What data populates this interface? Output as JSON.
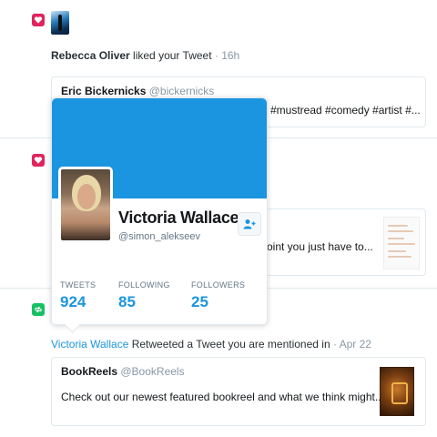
{
  "colors": {
    "accent": "#1b95e0",
    "like": "#e0245e",
    "retweet": "#17bf63",
    "muted": "#8899a6",
    "border": "#e1e8ed"
  },
  "notifications": [
    {
      "icon": "heart-icon",
      "actor": "Rebecca Oliver",
      "action": " liked your Tweet",
      "time": " · 16h",
      "quoted": {
        "author": "Eric Bickernicks",
        "handle": "@bickernicks",
        "text": "#mustread #comedy #artist #..."
      }
    },
    {
      "icon": "heart-icon",
      "quoted": {
        "text": "oint you just have to..."
      }
    },
    {
      "icon": "retweet-icon",
      "actor": "Victoria Wallace",
      "action": " Retweeted a Tweet you are mentioned in",
      "time": " · Apr 22",
      "quoted": {
        "author": "BookReels",
        "handle": "@BookReels",
        "text": "Check out our newest featured bookreel and what we think might..."
      }
    }
  ],
  "profile_card": {
    "name": "Victoria Wallace",
    "handle": "@simon_alekseev",
    "follow_icon": "add-user-icon",
    "stats": [
      {
        "label": "TWEETS",
        "value": "924"
      },
      {
        "label": "FOLLOWING",
        "value": "85"
      },
      {
        "label": "FOLLOWERS",
        "value": "25"
      }
    ]
  }
}
